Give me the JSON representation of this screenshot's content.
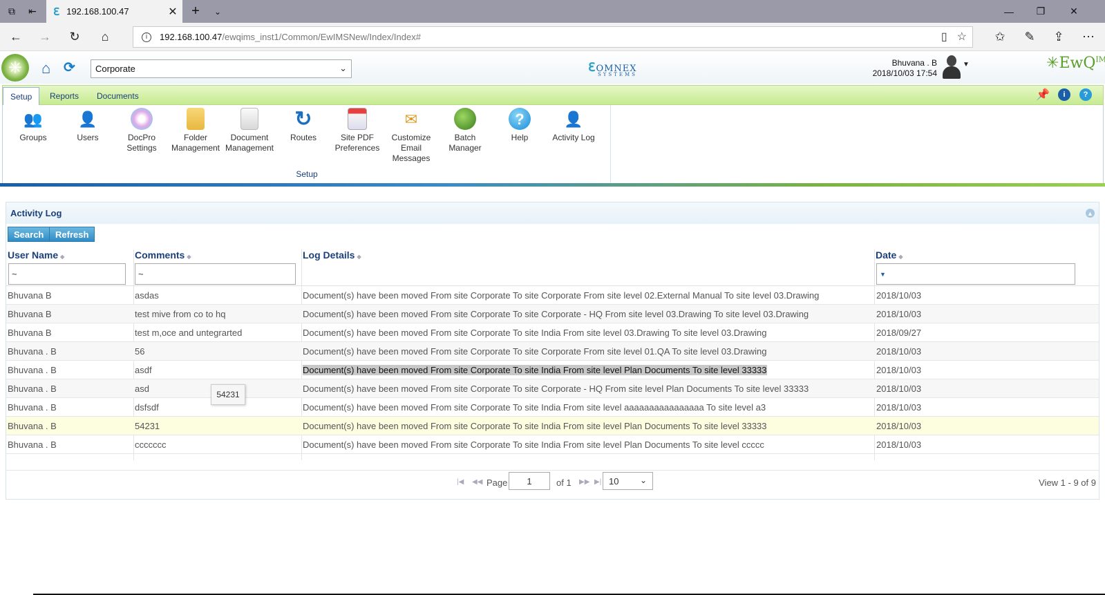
{
  "browser": {
    "tab_title": "192.168.100.47",
    "url_host": "192.168.100.47",
    "url_path": "/ewqims_inst1/Common/EwIMSNew/Index/Index#"
  },
  "header": {
    "site": "Corporate",
    "brand": "OMNEX",
    "brand_sub": "SYSTEMS",
    "user_name": "Bhuvana . B",
    "user_datetime": "2018/10/03 17:54",
    "app_logo": "EwQ",
    "app_logo_sup": "IMS"
  },
  "ribbon": {
    "tabs": [
      "Setup",
      "Reports",
      "Documents"
    ],
    "group_label": "Setup",
    "buttons": [
      {
        "label": "Groups",
        "icon": "groups-icon"
      },
      {
        "label": "Users",
        "icon": "users-icon"
      },
      {
        "label": "DocPro\nSettings",
        "icon": "docpro-settings-icon"
      },
      {
        "label": "Folder\nManagement",
        "icon": "folder-icon"
      },
      {
        "label": "Document\nManagement",
        "icon": "document-icon"
      },
      {
        "label": "Routes",
        "icon": "routes-icon"
      },
      {
        "label": "Site PDF\nPreferences",
        "icon": "pdf-icon"
      },
      {
        "label": "Customize\nEmail\nMessages",
        "icon": "email-icon"
      },
      {
        "label": "Batch\nManager",
        "icon": "batch-icon"
      },
      {
        "label": "Help",
        "icon": "help-icon"
      },
      {
        "label": "Activity Log",
        "icon": "activity-log-icon"
      }
    ]
  },
  "panel": {
    "title": "Activity Log",
    "search_label": "Search",
    "refresh_label": "Refresh"
  },
  "grid": {
    "columns": [
      "User Name",
      "Comments",
      "Log Details",
      "Date"
    ],
    "filters": {
      "user": "~",
      "comments": "~",
      "date": "▼"
    },
    "rows": [
      [
        "Bhuvana   B",
        "asdas",
        "Document(s) have been moved From site Corporate To site Corporate From site level 02.External Manual To site level  03.Drawing",
        "2018/10/03"
      ],
      [
        "Bhuvana   B",
        "test mive from co to hq",
        "Document(s) have been moved From site Corporate To site Corporate - HQ From site level 03.Drawing To site level  03.Drawing",
        "2018/10/03"
      ],
      [
        "Bhuvana  B",
        "test m,oce and untegrarted",
        "Document(s) have been moved From site Corporate To site India From site level 03.Drawing To site level  03.Drawing",
        "2018/09/27"
      ],
      [
        "Bhuvana . B",
        "56",
        "Document(s) have been moved From site Corporate To site Corporate From site level 01.QA To site level  03.Drawing",
        "2018/10/03"
      ],
      [
        "Bhuvana . B",
        "asdf",
        "Document(s) have been moved From site Corporate To site India From site level Plan Documents To site level  33333",
        "2018/10/03"
      ],
      [
        "Bhuvana . B",
        "asd",
        "Document(s) have been moved From site Corporate To site Corporate - HQ From site level Plan Documents To site level  33333",
        "2018/10/03"
      ],
      [
        "Bhuvana . B",
        "dsfsdf",
        "Document(s) have been moved From site Corporate To site India From site level aaaaaaaaaaaaaaaa To site level  a3",
        "2018/10/03"
      ],
      [
        "Bhuvana . B",
        "54231",
        "Document(s) have been moved From site Corporate To site India From site level Plan Documents To site level  33333",
        "2018/10/03"
      ],
      [
        "Bhuvana . B",
        "ccccccc",
        "Document(s) have been moved From site Corporate To site India From site level Plan Documents To site level  ccccc",
        "2018/10/03"
      ]
    ],
    "tooltip": "54231"
  },
  "pager": {
    "page_label": "Page",
    "page_value": "1",
    "of_label": "of 1",
    "page_size": "10",
    "view_info": "View 1 - 9 of 9"
  }
}
